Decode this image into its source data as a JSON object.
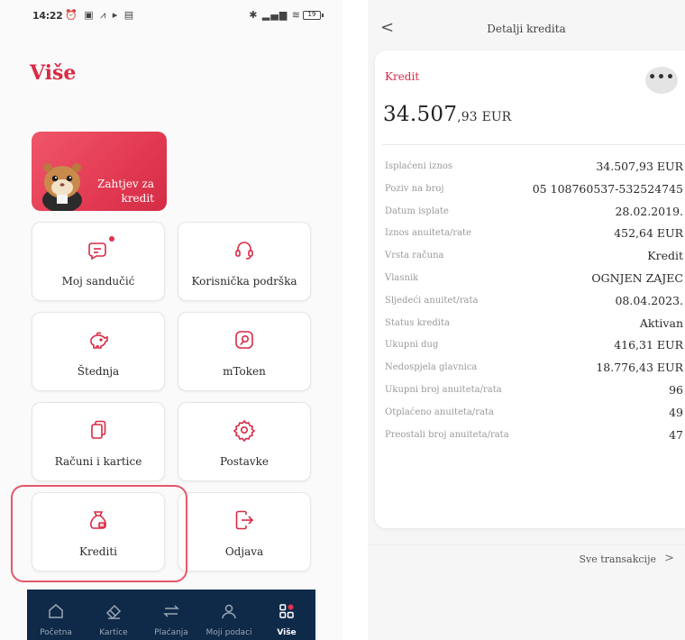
{
  "left_screen": {
    "status_bar": {
      "time": "14:22",
      "left_icons": "⏰ ▣ ⩘ ▸ ▤",
      "right_icons": "✱ ▂▄▆ ≋",
      "battery": "19"
    },
    "title": "Više",
    "banner": {
      "text": "Zahtjev za kredit"
    },
    "tiles": [
      {
        "label": "Moj sandučić",
        "icon": "mailbox-icon",
        "has_badge": true
      },
      {
        "label": "Korisnička podrška",
        "icon": "headset-icon"
      },
      {
        "label": "Štednja",
        "icon": "piggy-bank-icon"
      },
      {
        "label": "mToken",
        "icon": "token-icon"
      },
      {
        "label": "Računi i kartice",
        "icon": "cards-icon"
      },
      {
        "label": "Postavke",
        "icon": "gear-icon"
      },
      {
        "label": "Krediti",
        "icon": "money-bag-icon"
      },
      {
        "label": "Odjava",
        "icon": "logout-icon"
      }
    ],
    "tabs": [
      {
        "label": "Početna",
        "icon": "home-icon"
      },
      {
        "label": "Kartice",
        "icon": "card-icon"
      },
      {
        "label": "Plaćanja",
        "icon": "transfer-icon"
      },
      {
        "label": "Moji podaci",
        "icon": "user-icon"
      },
      {
        "label": "Više",
        "icon": "grid-icon",
        "active": true
      }
    ],
    "accent_color": "#d92a45",
    "tabbar_color": "#0f2a48"
  },
  "right_screen": {
    "nav_title": "Detalji kredita",
    "back_symbol": "<",
    "card_kind": "Kredit",
    "more_symbol": "•••",
    "amount": {
      "main": "34.507",
      "decimal": ",93",
      "currency": "EUR"
    },
    "details": [
      {
        "label": "Isplaćeni iznos",
        "value": "34.507,93 EUR"
      },
      {
        "label": "Poziv na broj",
        "value": "05 108760537-532524745"
      },
      {
        "label": "Datum isplate",
        "value": "28.02.2019."
      },
      {
        "label": "Iznos anuiteta/rate",
        "value": "452,64 EUR"
      },
      {
        "label": "Vrsta računa",
        "value": "Kredit"
      },
      {
        "label": "Vlasnik",
        "value": "OGNJEN ZAJEC"
      },
      {
        "label": "Sljedeći anuitet/rata",
        "value": "08.04.2023."
      },
      {
        "label": "Status kredita",
        "value": "Aktivan"
      },
      {
        "label": "Ukupni dug",
        "value": "416,31 EUR"
      },
      {
        "label": "Nedospjela glavnica",
        "value": "18.776,43 EUR"
      },
      {
        "label": "Ukupni broj anuiteta/rata",
        "value": "96"
      },
      {
        "label": "Otplaćeno anuiteta/rata",
        "value": "49"
      },
      {
        "label": "Preostali broj anuiteta/rata",
        "value": "47"
      }
    ],
    "transactions_link": "Sve transakcije",
    "transactions_chevron": ">"
  }
}
